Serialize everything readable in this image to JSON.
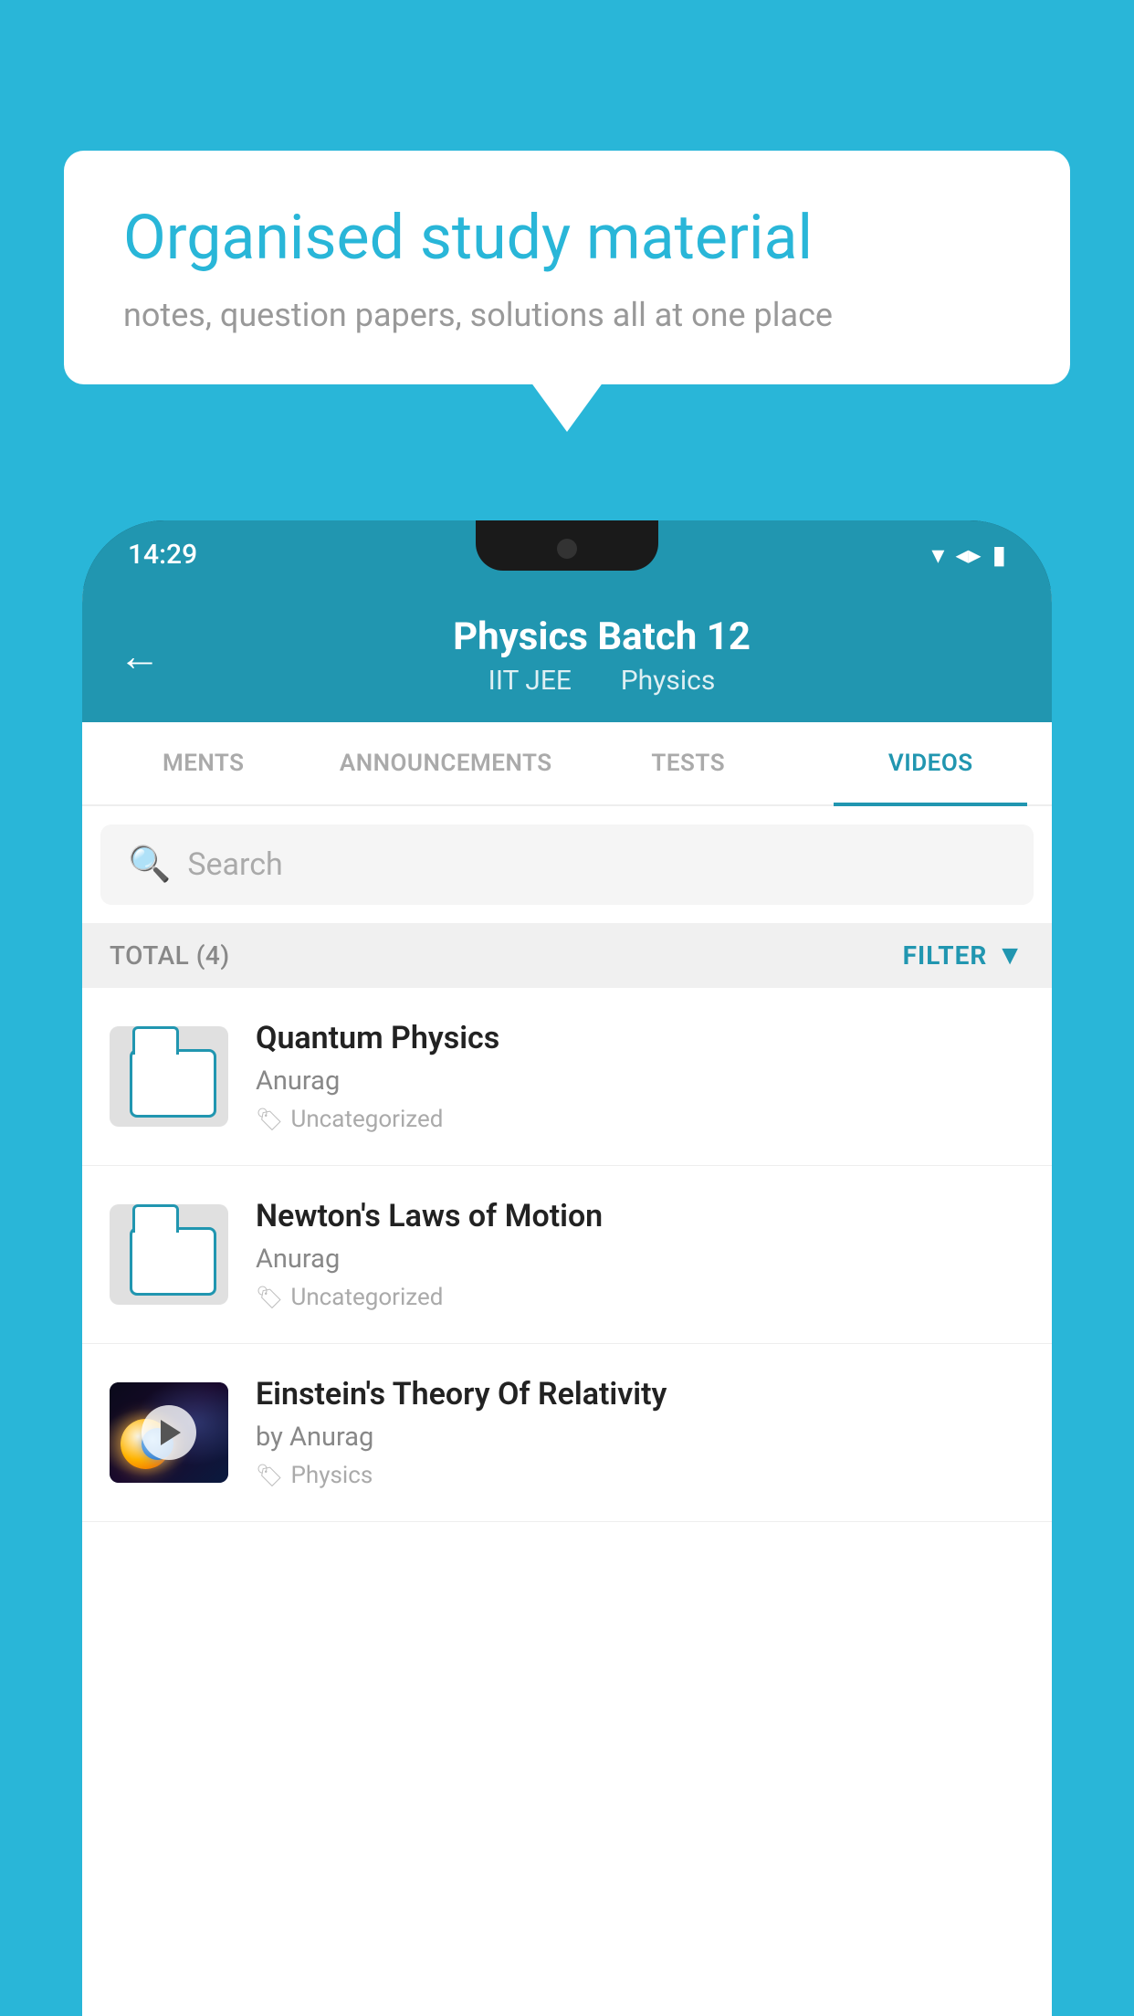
{
  "background_color": "#29b6d8",
  "speech_bubble": {
    "title": "Organised study material",
    "subtitle": "notes, question papers, solutions all at one place"
  },
  "status_bar": {
    "time": "14:29",
    "icons": [
      "wifi",
      "signal",
      "battery"
    ]
  },
  "app_header": {
    "back_label": "←",
    "title": "Physics Batch 12",
    "subtitle_parts": [
      "IIT JEE",
      "Physics"
    ]
  },
  "tabs": [
    {
      "label": "MENTS",
      "active": false
    },
    {
      "label": "ANNOUNCEMENTS",
      "active": false
    },
    {
      "label": "TESTS",
      "active": false
    },
    {
      "label": "VIDEOS",
      "active": true
    }
  ],
  "search": {
    "placeholder": "Search"
  },
  "filter_bar": {
    "total_label": "TOTAL (4)",
    "filter_label": "FILTER"
  },
  "video_items": [
    {
      "title": "Quantum Physics",
      "author": "Anurag",
      "tag": "Uncategorized",
      "has_thumbnail": false,
      "thumb_type": "folder"
    },
    {
      "title": "Newton's Laws of Motion",
      "author": "Anurag",
      "tag": "Uncategorized",
      "has_thumbnail": false,
      "thumb_type": "folder"
    },
    {
      "title": "Einstein's Theory Of Relativity",
      "author": "by Anurag",
      "tag": "Physics",
      "has_thumbnail": true,
      "thumb_type": "video"
    }
  ]
}
